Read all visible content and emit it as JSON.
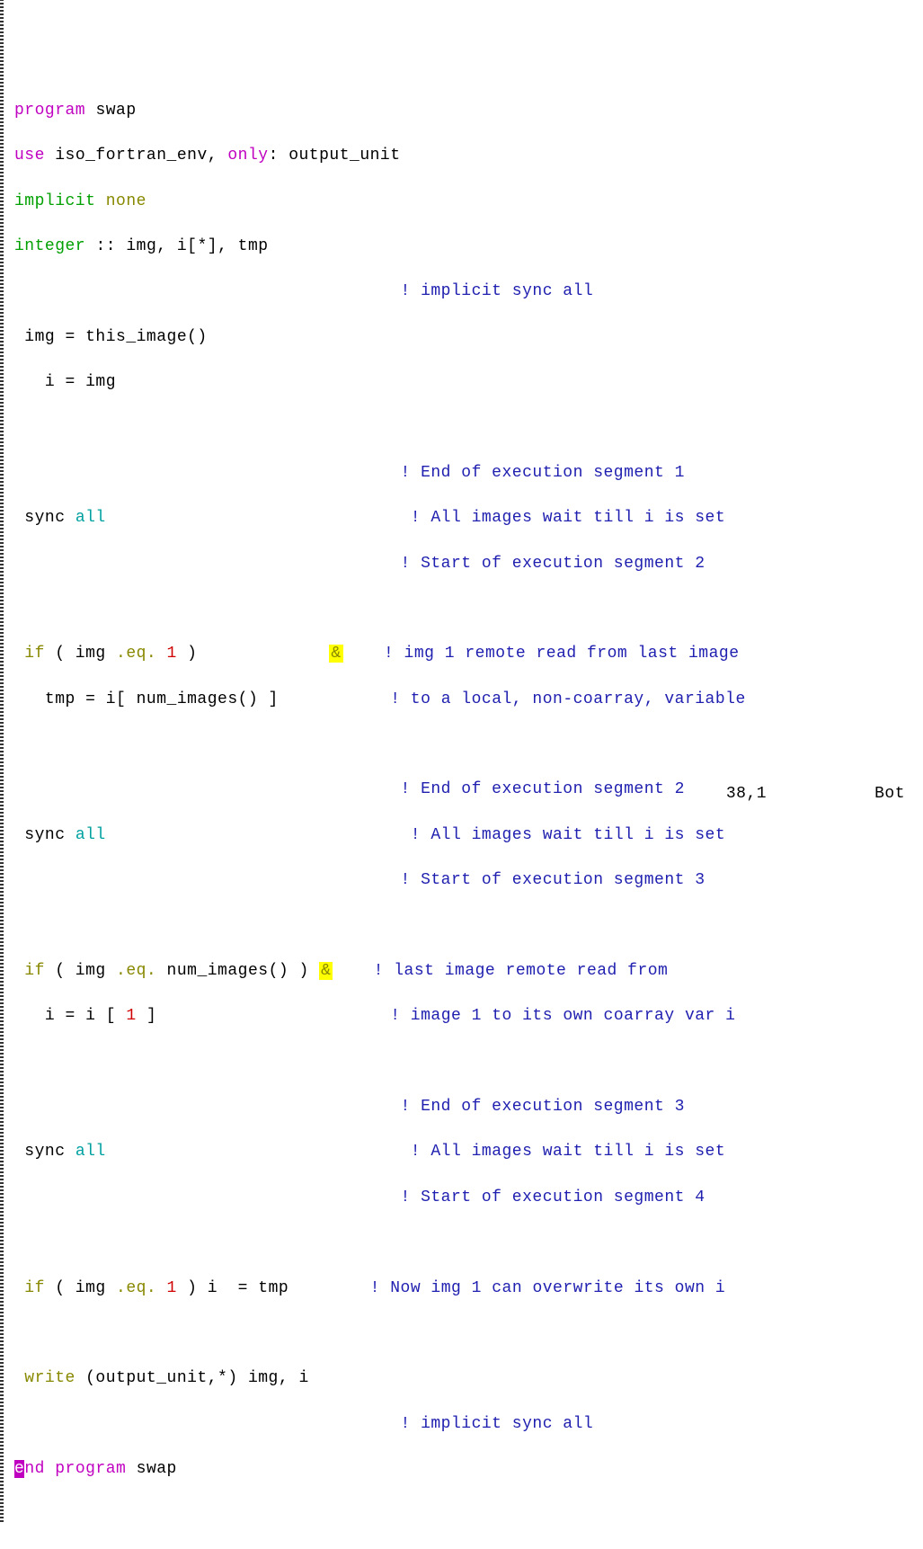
{
  "code": {
    "l1": {
      "program": "program",
      "name": "swap"
    },
    "l2": {
      "use": "use",
      "module": "iso_fortran_env",
      "only": "only",
      "colon": ":",
      "unit": "output_unit"
    },
    "l3": {
      "implicit": "implicit",
      "none": "none"
    },
    "l4": {
      "integer": "integer",
      "decl": ":: img, i[*], tmp"
    },
    "l5": {
      "comment": "! implicit sync all"
    },
    "l6": {
      "text": " img = this_image()"
    },
    "l7": {
      "text": "   i = img"
    },
    "l8": {
      "comment": "! End of execution segment 1"
    },
    "l9": {
      "sync": " sync ",
      "all": "all",
      "comment": "! All images wait till i is set"
    },
    "l10": {
      "comment": "! Start of execution segment 2"
    },
    "l11": {
      "if": " if",
      "paren": " ( img ",
      "eq": ".eq.",
      "num": " 1",
      "close": " )",
      "amp": "&",
      "comment": "! img 1 remote read from last image"
    },
    "l12": {
      "text": "   tmp = i[ num_images() ]",
      "comment": "! to a local, non-coarray, variable"
    },
    "l13": {
      "comment": "! End of execution segment 2"
    },
    "l14": {
      "sync": " sync ",
      "all": "all",
      "comment": "! All images wait till i is set"
    },
    "l15": {
      "comment": "! Start of execution segment 3"
    },
    "l16": {
      "if": " if",
      "paren": " ( img ",
      "eq": ".eq.",
      "rest": " num_images() ) ",
      "amp": "&",
      "comment": "! last image remote read from"
    },
    "l17": {
      "text": "   i = i [ ",
      "num": "1",
      "close": " ]",
      "comment": "! image 1 to its own coarray var i"
    },
    "l18": {
      "comment": "! End of execution segment 3"
    },
    "l19": {
      "sync": " sync ",
      "all": "all",
      "comment": "! All images wait till i is set"
    },
    "l20": {
      "comment": "! Start of execution segment 4"
    },
    "l21": {
      "if": " if",
      "paren": " ( img ",
      "eq": ".eq.",
      "num": " 1",
      "close": " ) i  = tmp",
      "comment": "! Now img 1 can overwrite its own i"
    },
    "l22": {
      "write": " write",
      "args": " (output_unit,*) img, i"
    },
    "l23": {
      "comment": "! implicit sync all"
    },
    "l24": {
      "e": "e",
      "nd": "nd",
      "program": " program",
      "name": " swap"
    }
  },
  "status": {
    "position": "38,1",
    "location": "Bot"
  }
}
